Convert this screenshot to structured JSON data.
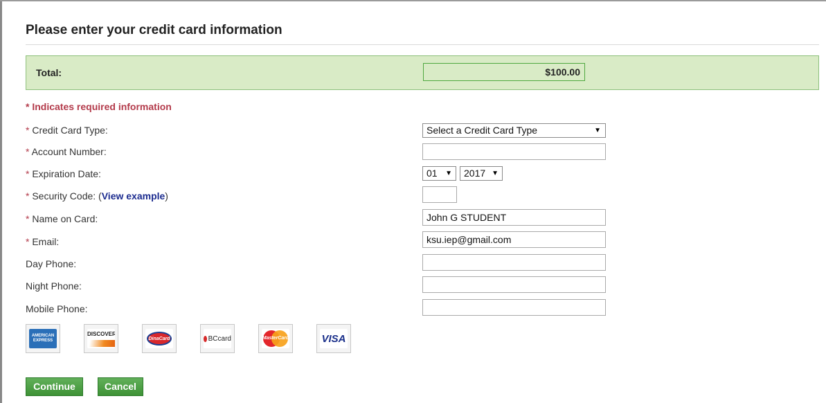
{
  "page": {
    "title": "Please enter your credit card information"
  },
  "total": {
    "label": "Total:",
    "value": "$100.00"
  },
  "required_note": "* Indicates required information",
  "fields": {
    "card_type": {
      "req": "* ",
      "label": "Credit Card Type:",
      "selected": "Select a Credit Card Type"
    },
    "account_number": {
      "req": "* ",
      "label": "Account Number:",
      "value": ""
    },
    "expiration": {
      "req": "* ",
      "label": "Expiration Date:",
      "month": "01",
      "year": "2017"
    },
    "security_code": {
      "req": "* ",
      "label": "Security Code: (",
      "link": "View example",
      "suffix": ")",
      "value": ""
    },
    "name_on_card": {
      "req": "* ",
      "label": "Name on Card:",
      "value": "John G STUDENT"
    },
    "email": {
      "req": "* ",
      "label": "Email:",
      "value": "ksu.iep@gmail.com"
    },
    "day_phone": {
      "label": "Day Phone:",
      "value": ""
    },
    "night_phone": {
      "label": "Night Phone:",
      "value": ""
    },
    "mobile_phone": {
      "label": "Mobile Phone:",
      "value": ""
    }
  },
  "card_logos": {
    "amex_line1": "AMERICAN",
    "amex_line2": "EXPRESS",
    "discover": "DISCOVER",
    "dinacard": "DinaCard",
    "bccard": "BCcard",
    "mastercard": "MasterCard",
    "visa": "VISA"
  },
  "buttons": {
    "continue": "Continue",
    "cancel": "Cancel"
  },
  "icons": {
    "dropdown_arrow": "▼"
  },
  "colors": {
    "required": "#b33a4a",
    "total_bg": "#d9ebc6",
    "button_green": "#3e9236",
    "link": "#1b2b8f"
  }
}
